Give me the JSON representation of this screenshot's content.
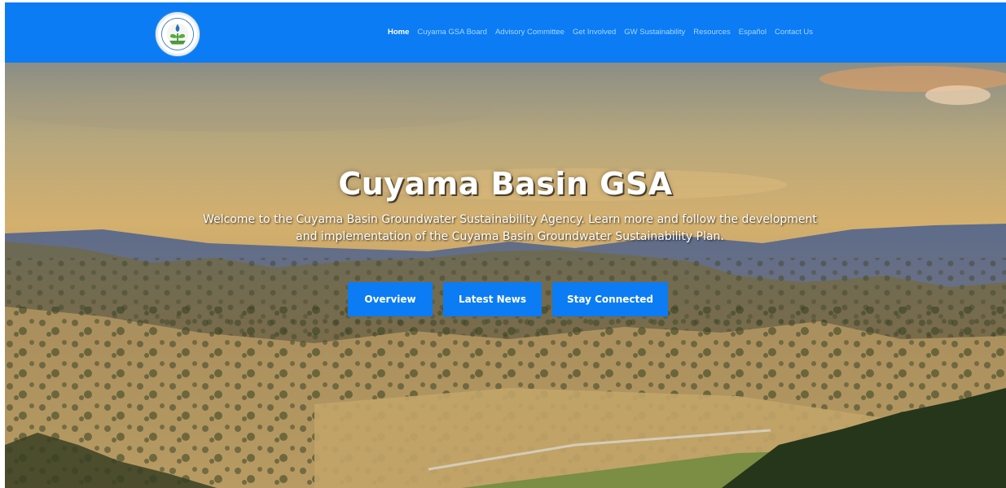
{
  "header": {
    "logo_icon": "cuyama-basin-gsa-seal-logo",
    "nav": [
      {
        "label": "Home",
        "active": true
      },
      {
        "label": "Cuyama GSA Board"
      },
      {
        "label": "Advisory Committee"
      },
      {
        "label": "Get Involved"
      },
      {
        "label": "GW Sustainability"
      },
      {
        "label": "Resources"
      },
      {
        "label": "Español"
      },
      {
        "label": "Contact Us"
      }
    ]
  },
  "hero": {
    "title": "Cuyama Basin GSA",
    "subtitle_line1": "Welcome to the Cuyama Basin Groundwater Sustainability Agency. Learn more and follow the development",
    "subtitle_line2": "and implementation of the Cuyama Basin Groundwater Sustainability Plan.",
    "buttons": {
      "overview": "Overview",
      "news": "Latest News",
      "stay": "Stay Connected"
    },
    "background": "golden-hills-valley-sunset-photo"
  },
  "colors": {
    "brand_blue": "#0b7cf4",
    "nav_inactive": "#a9d5ff",
    "nav_active": "#ffffff"
  }
}
